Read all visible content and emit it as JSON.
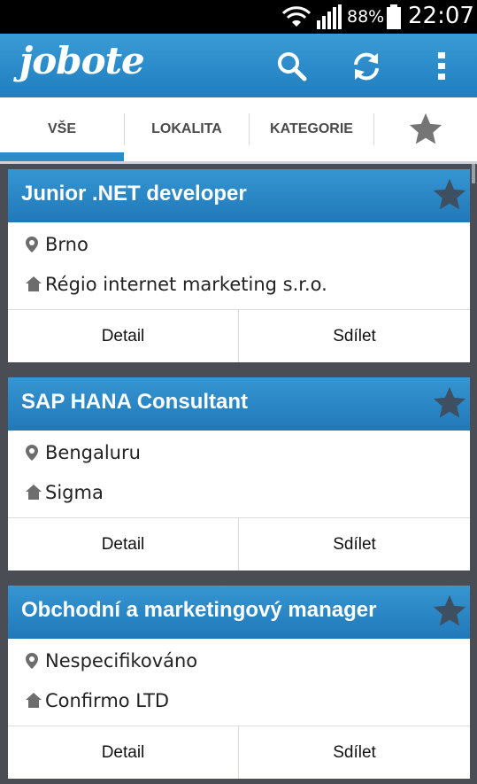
{
  "status_bar": {
    "battery": "88%",
    "time": "22:07"
  },
  "app_bar": {
    "logo": "jobote",
    "icons": [
      "search-icon",
      "refresh-icon",
      "overflow-menu-icon"
    ]
  },
  "tabs": [
    {
      "label": "VŠE",
      "active": true
    },
    {
      "label": "LOKALITA",
      "active": false
    },
    {
      "label": "KATEGORIE",
      "active": false
    },
    {
      "label": "",
      "icon": "star-icon",
      "active": false
    }
  ],
  "jobs": [
    {
      "title": "Junior .NET developer",
      "location": "Brno",
      "company": "Régio internet marketing s.r.o.",
      "detail_label": "Detail",
      "share_label": "Sdílet"
    },
    {
      "title": "SAP HANA Consultant",
      "location": "Bengaluru",
      "company": "Sigma",
      "detail_label": "Detail",
      "share_label": "Sdílet"
    },
    {
      "title": "Obchodní a marketingový manager",
      "location": "Nespecifikováno",
      "company": "Confirmo LTD",
      "detail_label": "Detail",
      "share_label": "Sdílet"
    }
  ],
  "colors": {
    "accent": "#2a8bc8",
    "background": "#4a4d54",
    "header": "#2178b8"
  }
}
